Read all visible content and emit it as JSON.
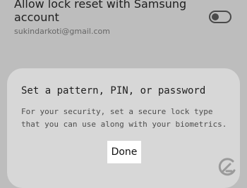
{
  "setting": {
    "title": "Allow lock reset with Samsung account",
    "account_email": "sukindarkoti@gmail.com",
    "toggle_on": false
  },
  "dialog": {
    "title": "Set a pattern, PIN, or password",
    "message": "For your security, set a secure lock type that you can use along with your biometrics.",
    "done_label": "Done"
  },
  "icons": {
    "watermark": "gadgets-logo-icon"
  },
  "colors": {
    "background": "#bdbdbd",
    "dialog_background": "#d7d7d7",
    "button_background": "#ffffff"
  }
}
